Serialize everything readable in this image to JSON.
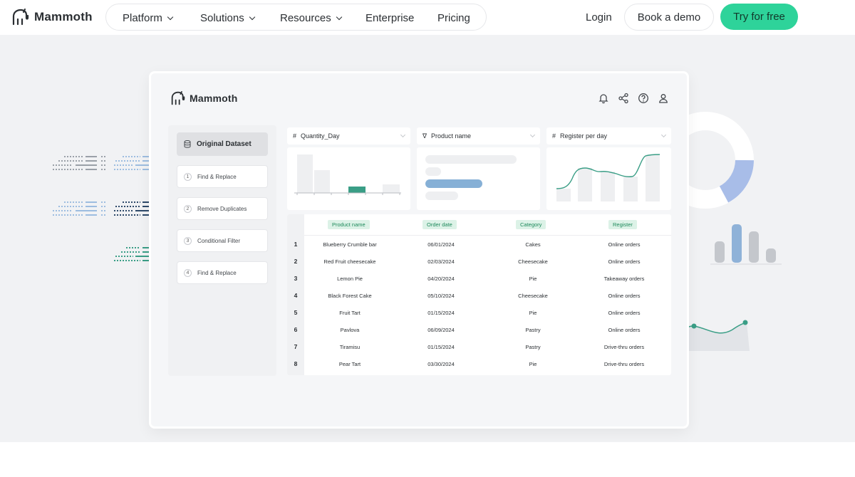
{
  "nav": {
    "brand": "Mammoth",
    "items": [
      {
        "label": "Platform",
        "dropdown": true
      },
      {
        "label": "Solutions",
        "dropdown": true
      },
      {
        "label": "Resources",
        "dropdown": true
      },
      {
        "label": "Enterprise",
        "dropdown": false
      },
      {
        "label": "Pricing",
        "dropdown": false
      }
    ],
    "login": "Login",
    "demo": "Book a demo",
    "try": "Try for free"
  },
  "app": {
    "brand": "Mammoth",
    "icons": [
      "bell-icon",
      "share-icon",
      "help-icon",
      "user-icon"
    ],
    "sidebar": {
      "active": "Original Dataset",
      "steps": [
        {
          "num": "1",
          "label": "Find & Replace"
        },
        {
          "num": "2",
          "label": "Remove Duplicates"
        },
        {
          "num": "3",
          "label": "Conditional Filter"
        },
        {
          "num": "4",
          "label": "Find & Replace"
        }
      ]
    },
    "columns": [
      {
        "icon": "#",
        "label": "Quantity_Day"
      },
      {
        "icon": "∇",
        "label": "Product name"
      },
      {
        "icon": "#",
        "label": "Register per day"
      }
    ],
    "table": {
      "headers": [
        "Product name",
        "Order date",
        "Category",
        "Register"
      ],
      "rows": [
        {
          "n": "1",
          "cells": [
            "Blueberry Crumble bar",
            "06/01/2024",
            "Cakes",
            "Online orders"
          ]
        },
        {
          "n": "2",
          "cells": [
            "Red Fruit cheesecake",
            "02/03/2024",
            "Cheesecake",
            "Online orders"
          ]
        },
        {
          "n": "3",
          "cells": [
            "Lemon Pie",
            "04/20/2024",
            "Pie",
            "Takeaway orders"
          ]
        },
        {
          "n": "4",
          "cells": [
            "Black Forest Cake",
            "05/10/2024",
            "Cheesecake",
            "Online orders"
          ]
        },
        {
          "n": "5",
          "cells": [
            "Fruit Tart",
            "01/15/2024",
            "Pie",
            "Online orders"
          ]
        },
        {
          "n": "6",
          "cells": [
            "Pavlova",
            "06/09/2024",
            "Pastry",
            "Online orders"
          ]
        },
        {
          "n": "7",
          "cells": [
            "Tiramisu",
            "01/15/2024",
            "Pastry",
            "Drive-thru orders"
          ]
        },
        {
          "n": "8",
          "cells": [
            "Pear Tart",
            "03/30/2024",
            "Pie",
            "Drive-thru orders"
          ]
        }
      ]
    }
  },
  "colors": {
    "accent": "#2ed39a",
    "teal": "#3a9e86",
    "blue": "#7fa9d1",
    "badge_bg": "#dcf2e7",
    "badge_text": "#1f8a5c"
  }
}
